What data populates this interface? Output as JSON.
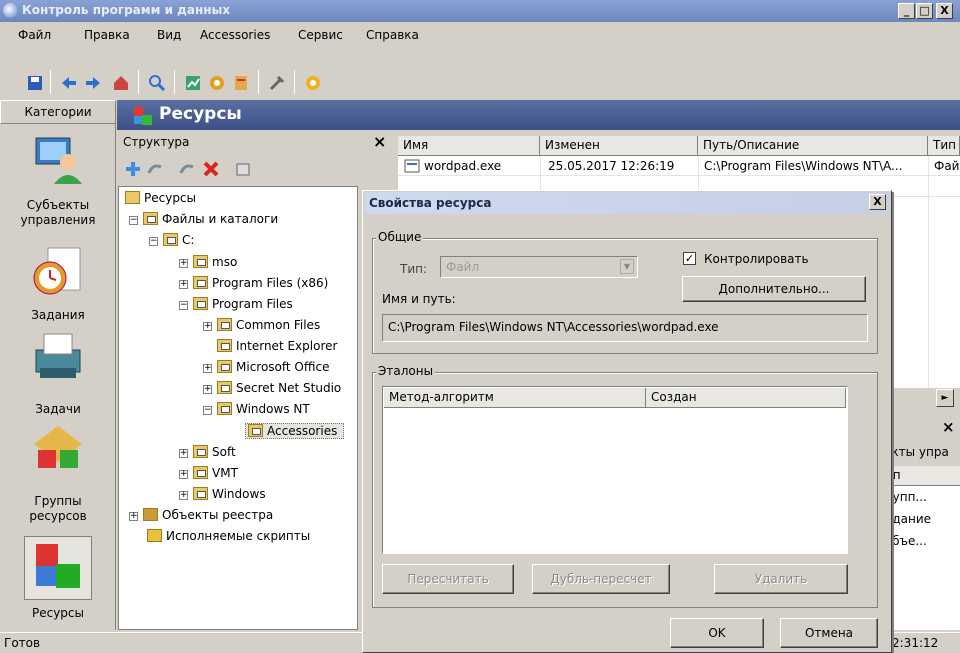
{
  "window": {
    "title": "Контроль программ и данных"
  },
  "window_buttons": {
    "minimize": "_",
    "maximize": "□",
    "close": "X"
  },
  "menu": [
    {
      "label": "Файл"
    },
    {
      "label": "Правка"
    },
    {
      "label": "Вид"
    },
    {
      "label": "Accessories"
    },
    {
      "label": "Сервис"
    },
    {
      "label": "Справка"
    }
  ],
  "categories": {
    "header": "Категории",
    "items": [
      {
        "label_1": "Субъекты",
        "label_2": "управления"
      },
      {
        "label_1": "Задания",
        "label_2": ""
      },
      {
        "label_1": "Задачи",
        "label_2": ""
      },
      {
        "label_1": "Группы",
        "label_2": "ресурсов"
      },
      {
        "label_1": "Ресурсы",
        "label_2": ""
      }
    ]
  },
  "resources_header": "Ресурсы",
  "structure": {
    "title": "Структура",
    "close": "×",
    "tree": [
      {
        "label": "Ресурсы"
      },
      {
        "label": "Файлы и каталоги"
      },
      {
        "label": "C:"
      },
      {
        "label": "mso"
      },
      {
        "label": "Program Files (x86)"
      },
      {
        "label": "Program Files"
      },
      {
        "label": "Common Files"
      },
      {
        "label": "Internet Explorer"
      },
      {
        "label": "Microsoft Office"
      },
      {
        "label": "Secret Net Studio"
      },
      {
        "label": "Windows NT"
      },
      {
        "label": "Accessories"
      },
      {
        "label": "Soft"
      },
      {
        "label": "VMT"
      },
      {
        "label": "Windows"
      },
      {
        "label": "Объекты реестра"
      },
      {
        "label": "Исполняемые скрипты"
      }
    ]
  },
  "list": {
    "columns": [
      "Имя",
      "Изменен",
      "Путь/Описание",
      "Тип"
    ],
    "rows": [
      {
        "name": "wordpad.exe",
        "modified": "25.05.2017 12:26:19",
        "path": "C:\\Program Files\\Windows NT\\A...",
        "type": "Фай"
      }
    ]
  },
  "lower_right": {
    "close": "×",
    "scroll_arrow": "►",
    "header": "екты упра",
    "col": "ип",
    "items": [
      "рупп...",
      "адание",
      "убъе..."
    ]
  },
  "status": {
    "text": "Готов",
    "time": "2:31:12"
  },
  "dialog": {
    "title": "Свойства ресурса",
    "close": "X",
    "general_group": "Общие",
    "type_label": "Тип:",
    "type_value": "Файл",
    "control_checkbox": "Контролировать",
    "control_checked": true,
    "advanced_button": "Дополнительно...",
    "path_label": "Имя и путь:",
    "path_value": "C:\\Program Files\\Windows NT\\Accessories\\wordpad.exe",
    "standards_group": "Эталоны",
    "standards_columns": [
      "Метод-алгоритм",
      "Создан"
    ],
    "recalc_button": "Пересчитать",
    "dup_recalc_button": "Дубль-пересчет",
    "delete_button": "Удалить",
    "ok_button": "OK",
    "cancel_button": "Отмена"
  }
}
